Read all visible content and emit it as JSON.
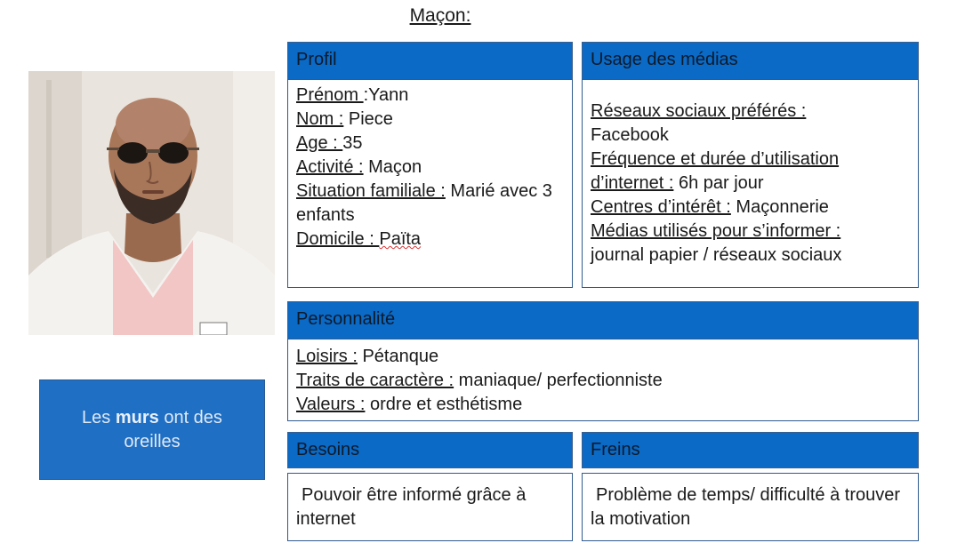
{
  "title": "Maçon:",
  "photo": {
    "description_icon": "portrait-photo"
  },
  "quote": {
    "before": "Les ",
    "bold": "murs",
    "after": " ont des oreilles"
  },
  "profil": {
    "header": "Profil",
    "prenom_label": "Prénom ",
    "prenom_value": ":Yann",
    "nom_label": "Nom :",
    "nom_value": " Piece",
    "age_label": "Age : ",
    "age_value": "35",
    "activite_label": "Activité :",
    "activite_value": " Maçon",
    "situation_label": "Situation familiale :",
    "situation_value": " Marié avec 3 enfants",
    "domicile_label": "Domicile : ",
    "domicile_value": "Païta"
  },
  "medias": {
    "header": "Usage des médias",
    "reseaux_label": "Réseaux sociaux préférés :",
    "reseaux_value": "Facebook",
    "frequence_label": "Fréquence et durée d’utilisation d’internet :",
    "frequence_value": " 6h par jour",
    "centres_label": "Centres d’intérêt :",
    "centres_value": " Maçonnerie",
    "medias_label": "Médias utilisés pour s’informer :",
    "medias_value": "journal papier / réseaux sociaux"
  },
  "personnalite": {
    "header": "Personnalité",
    "loisirs_label": "Loisirs :",
    "loisirs_value": " Pétanque",
    "traits_label": "Traits de caractère :",
    "traits_value": " maniaque/ perfectionniste",
    "valeurs_label": "Valeurs :",
    "valeurs_value": " ordre et esthétisme"
  },
  "besoins": {
    "header": "Besoins",
    "text": "Pouvoir être informé grâce à internet"
  },
  "freins": {
    "header": "Freins",
    "text": "Problème de temps/ difficulté à trouver la motivation"
  },
  "colors": {
    "header_blue": "#0a6ac6",
    "quote_blue": "#1f6fc4",
    "border": "#2f5b8e"
  }
}
